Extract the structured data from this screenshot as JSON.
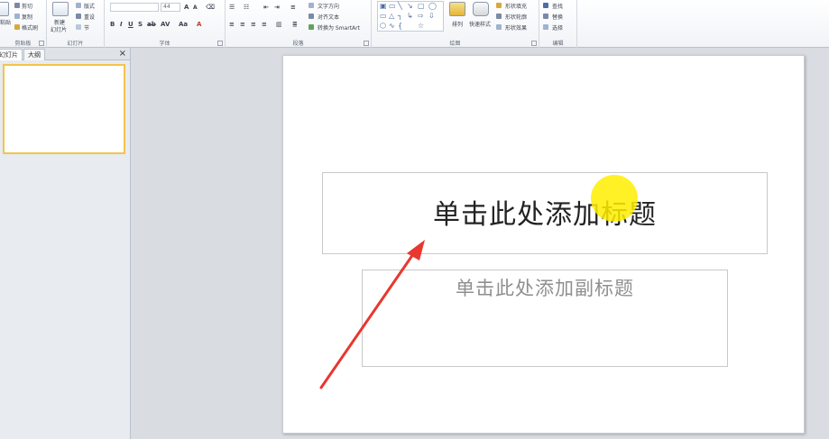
{
  "ribbon": {
    "clipboard": {
      "paste": "粘贴",
      "cut": "剪切",
      "copy": "复制",
      "format_painter": "格式刷",
      "group": "剪贴板"
    },
    "slides": {
      "new_slide": "新建",
      "new_slide_2": "幻灯片",
      "layout": "版式",
      "reset": "重设",
      "section": "节",
      "group": "幻灯片"
    },
    "font": {
      "size": "44",
      "group": "字体"
    },
    "paragraph": {
      "text_direction": "文字方向",
      "align_text": "对齐文本",
      "smartart": "转换为 SmartArt",
      "group": "段落"
    },
    "drawing": {
      "arrange": "排列",
      "quick_styles": "快速样式",
      "shape_fill": "形状填充",
      "shape_outline": "形状轮廓",
      "shape_effects": "形状效果",
      "group": "绘图"
    },
    "editing": {
      "find": "查找",
      "replace": "替换",
      "select": "选择",
      "group": "编辑"
    }
  },
  "panel": {
    "tab_slides": "幻灯片",
    "tab_outline": "大纲",
    "close": "×"
  },
  "slide": {
    "title_placeholder": "单击此处添加标题",
    "subtitle_placeholder": "单击此处添加副标题"
  },
  "colors": {
    "highlight": "#ffee00",
    "arrow": "#e8382f",
    "thumb_border": "#f2c44b"
  }
}
